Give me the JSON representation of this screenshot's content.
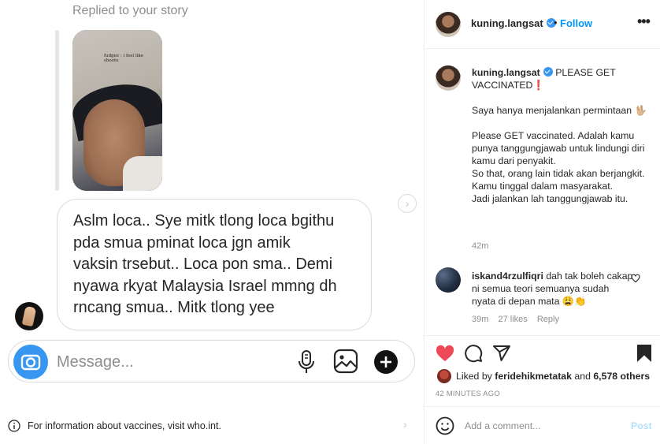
{
  "dm": {
    "replied_label": "Replied to your story",
    "story_caption": "fudgee : i feel like shoote",
    "message_lines": [
      "Aslm loca.. Sye mitk tlong loca bgithu",
      "pda smua pminat loca jgn amik",
      "vaksin trsebut.. Loca pon sma.. Demi",
      "nyawa rkyat Malaysia Israel mmng dh",
      "rncang smua.. Mitk tlong yee"
    ],
    "composer_placeholder": "Message...",
    "icons": [
      "camera-icon",
      "microphone-icon",
      "gallery-icon",
      "sticker-icon"
    ]
  },
  "vaccine_banner": {
    "text": "For information about vaccines, visit who.int."
  },
  "post": {
    "header": {
      "username": "kuning.langsat",
      "dot": "•",
      "follow_label": "Follow",
      "more_label": "•••"
    },
    "caption": {
      "username": "kuning.langsat",
      "line1": "PLEASE GET VACCINATED❗",
      "line2": "Saya hanya menjalankan permintaan 🖖🏼",
      "line3": "Please GET vaccinated. Adalah kamu punya tanggungjawab untuk lindungi diri kamu dari penyakit.",
      "line4": "So that, orang lain tidak akan berjangkit.",
      "line5": "Kamu tinggal dalam masyarakat.",
      "line6": "Jadi jalankan lah tanggungjawab itu.",
      "time": "42m"
    },
    "comment": {
      "username": "iskand4rzulfiqri",
      "text": "dah tak boleh cakap ni semua teori semuanya sudah nyata di depan mata 😩👏",
      "time": "39m",
      "likes": "27 likes",
      "reply_label": "Reply"
    },
    "likes": {
      "prefix": "Liked by",
      "user": "feridehikmetatak",
      "conjunction": "and",
      "others": "6,578 others"
    },
    "age": "42 MINUTES AGO",
    "add_comment": {
      "placeholder": "Add a comment...",
      "post_label": "Post"
    },
    "colors": {
      "like": "#ed4956",
      "link": "#0095f6",
      "post_disabled": "#b2dffc"
    }
  }
}
